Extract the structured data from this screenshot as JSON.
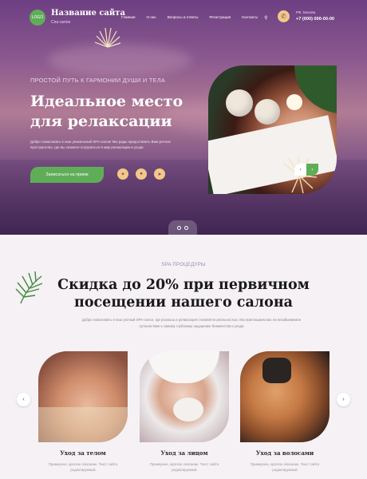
{
  "header": {
    "logo_text": "LOGO",
    "site_title": "Название сайта",
    "site_subtitle": "Спа салон",
    "nav": [
      "Главная",
      "О нас",
      "Вопросы и ответы",
      "Регистрация",
      "Контакты"
    ],
    "search_icon": "search-icon",
    "city": "РФ, Москва",
    "phone": "+7 (000) 000-00-00"
  },
  "hero": {
    "kicker": "ПРОСТОЙ ПУТЬ К ГАРМОНИИ ДУШИ И ТЕЛА",
    "title": "Идеальное место для релаксации",
    "description": "Добро пожаловать в наш уникальный SPA-салон! Мы рады предоставить Вам уютное пространство, где вы сможете погрузиться в мир релаксации и ухода",
    "cta_label": "Записаться на прием",
    "social": [
      "vk-icon",
      "ok-icon",
      "telegram-icon"
    ],
    "slider_prev": "‹",
    "slider_next": "›"
  },
  "procedures": {
    "kicker": "SPA ПРОЦЕДУРЫ",
    "title": "Скидка до 20% при первичном посещении нашего салона",
    "description": "Добро пожаловать в наш уютный SPA-салон, где роскошь и релаксация становятся реальностью. Мы приглашаем вас на незабываемое путешествие к самому глубокому ощущению блаженства и ухода",
    "cards": [
      {
        "title": "Уход за телом",
        "description": "Примерное, краткое описание. Текст сайта редактируемый"
      },
      {
        "title": "Уход за лицом",
        "description": "Примерное, краткое описание. Текст сайта редактируемый"
      },
      {
        "title": "Уход за волосами",
        "description": "Примерное, краткое описание. Текст сайта редактируемый"
      }
    ]
  },
  "colors": {
    "accent_green": "#5fae57",
    "accent_gold": "#f2c985",
    "hero_purple": "#6d3f83"
  }
}
